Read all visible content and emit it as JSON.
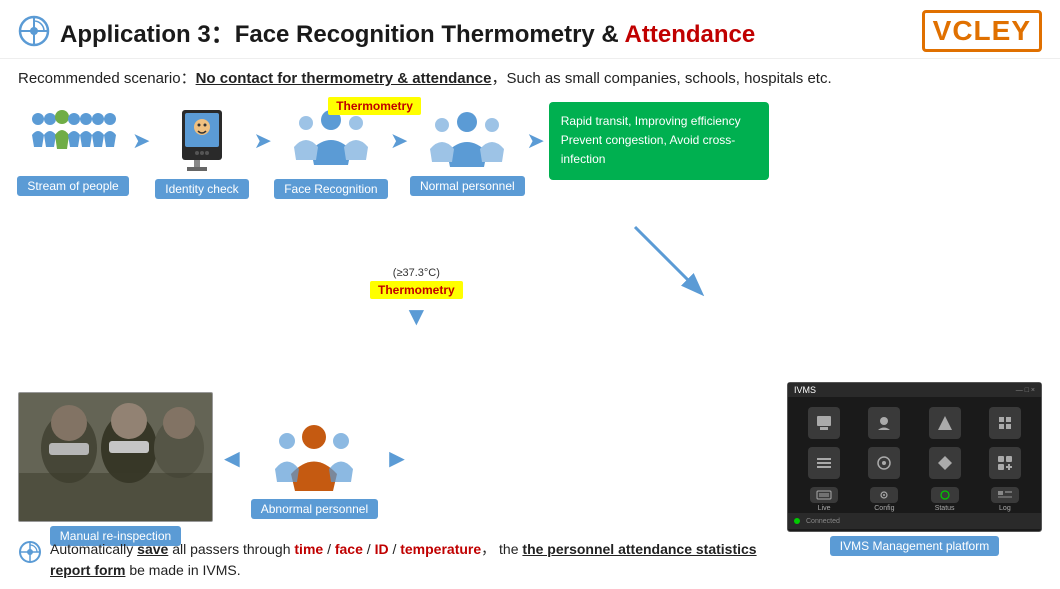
{
  "header": {
    "title_prefix": "Application 3：",
    "title_mid": "Face Recognition Thermometry & ",
    "title_accent": "Attendance",
    "logo": "VCLEY"
  },
  "scenario": {
    "label": "Recommended scenario：",
    "underline_text": "No contact for thermometry & attendance",
    "rest": "，Such as small companies, schools, hospitals etc."
  },
  "flow": {
    "stream_label": "Stream of people",
    "identity_label": "Identity check",
    "face_rec_label": "Face Recognition",
    "normal_label": "Normal personnel",
    "thermo_badge": "Thermometry",
    "thermo_badge2": "Thermometry",
    "temp_text": "(≥37.3°C)",
    "abnormal_label": "Abnormal personnel",
    "manual_label": "Manual re-inspection",
    "ivms_label": "IVMS Management platform",
    "green_box_line1": "Rapid transit, Improving efficiency",
    "green_box_line2": "Prevent congestion, Avoid cross-infection"
  },
  "ivms": {
    "title": "IVMS",
    "icons": [
      {
        "label": ""
      },
      {
        "label": ""
      },
      {
        "label": ""
      },
      {
        "label": ""
      },
      {
        "label": ""
      },
      {
        "label": ""
      },
      {
        "label": ""
      },
      {
        "label": ""
      },
      {
        "label": "Live"
      },
      {
        "label": "Config"
      },
      {
        "label": "Status"
      },
      {
        "label": "Log"
      }
    ]
  },
  "footer": {
    "text_start": "Automatically ",
    "save": "save",
    "text_mid": " all passers through ",
    "time": "time",
    "slash1": " / ",
    "face": "face",
    "slash2": " / ",
    "id": "ID",
    "slash3": " / ",
    "temperature": "temperature",
    "comma": "，",
    "text_the": " the ",
    "stats": "the personnel attendance statistics",
    "report": "report form",
    "text_end": " be made in IVMS."
  }
}
